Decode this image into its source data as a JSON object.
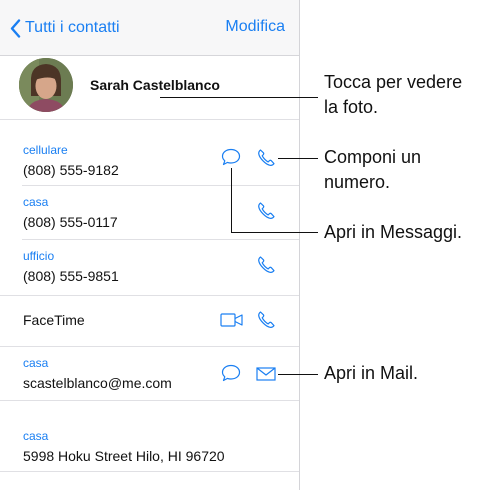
{
  "navbar": {
    "back_label": "Tutti i contatti",
    "edit_label": "Modifica"
  },
  "contact": {
    "name": "Sarah Castelblanco"
  },
  "fields": [
    {
      "label": "cellulare",
      "value": "(808) 555-9182"
    },
    {
      "label": "casa",
      "value": "(808) 555-0117"
    },
    {
      "label": "ufficio",
      "value": "(808) 555-9851"
    }
  ],
  "facetime": {
    "label": "FaceTime"
  },
  "email": {
    "label": "casa",
    "value": "scastelblanco@me.com"
  },
  "address": {
    "label": "casa",
    "value": "5998 Hoku Street Hilo, HI 96720"
  },
  "callouts": {
    "photo_line1": "Tocca per vedere",
    "photo_line2": "la foto.",
    "call_line1": "Componi un",
    "call_line2": "numero.",
    "messages": "Apri in Messaggi.",
    "mail": "Apri in Mail."
  },
  "colors": {
    "accent": "#1a7ff2"
  }
}
